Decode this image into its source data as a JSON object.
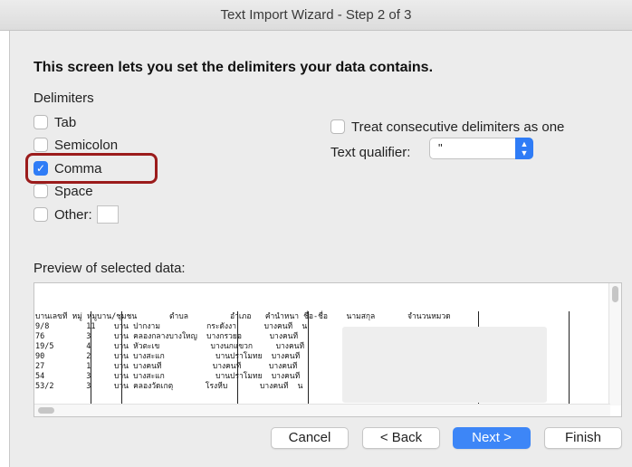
{
  "window": {
    "title": "Text Import Wizard - Step 2 of 3"
  },
  "heading": "This screen lets you set the delimiters your data contains.",
  "delimiters": {
    "label": "Delimiters",
    "tab": {
      "label": "Tab",
      "checked": false
    },
    "semicolon": {
      "label": "Semicolon",
      "checked": false
    },
    "comma": {
      "label": "Comma",
      "checked": true
    },
    "space": {
      "label": "Space",
      "checked": false
    },
    "other": {
      "label": "Other:",
      "checked": false,
      "value": ""
    }
  },
  "options": {
    "consecutive_label": "Treat consecutive delimiters as one",
    "consecutive_checked": false,
    "qualifier_label": "Text qualifier:",
    "qualifier_value": "\""
  },
  "preview": {
    "label": "Preview of selected data:",
    "rows": [
      "บานเลขที หมู่ หมูบาน/ชุมชน       ตำบล         อำเภอ   คำนำหนา ชื่อ-ชื่อ    นามสกุล       จำนวนหมวด",
      "9/8        11    บาน ปากงาม          กระดังงา      บางคนที  น",
      "76         3     บาน คลองกลางบางใหญ  บางกรวยอ      บางคนที",
      "19/5       4     บาน หัวตะเข           บางนกแขวก     บางคนที",
      "90         2     บาน บางสะแก           บานปราโมทย  บางคนที",
      "27         1     บาน บางคนที           บางคนที      บางคนที",
      "54         3     บาน บางสะแก           บานปราโมทย  บางคนที                                              0",
      "53/2       3     บาน คลองวัดเกตุ       โรงหีบ       บางคนที  น"
    ]
  },
  "buttons": {
    "cancel": "Cancel",
    "back": "< Back",
    "next": "Next >",
    "finish": "Finish"
  },
  "colors": {
    "accent": "#2f7cf6",
    "highlight": "#9b1b1b"
  }
}
